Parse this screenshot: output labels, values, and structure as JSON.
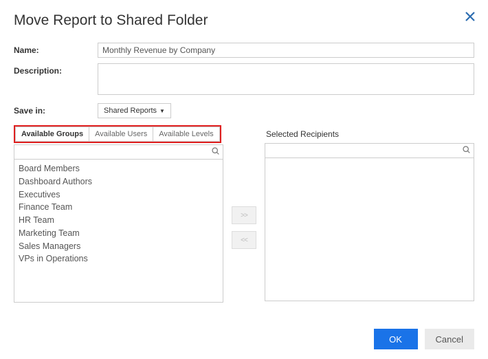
{
  "dialog": {
    "title": "Move Report to Shared Folder"
  },
  "form": {
    "name_label": "Name:",
    "name_value": "Monthly Revenue by Company",
    "description_label": "Description:",
    "description_value": "",
    "save_in_label": "Save in:",
    "save_in_value": "Shared Reports"
  },
  "tabs": {
    "groups": "Available Groups",
    "users": "Available Users",
    "levels": "Available Levels"
  },
  "selected_header": "Selected Recipients",
  "available_list": [
    "Board Members",
    "Dashboard Authors",
    "Executives",
    "Finance Team",
    "HR Team",
    "Marketing Team",
    "Sales Managers",
    "VPs in Operations"
  ],
  "selected_list": [],
  "transfer": {
    "add": ">>",
    "remove": "<<"
  },
  "buttons": {
    "ok": "OK",
    "cancel": "Cancel"
  }
}
